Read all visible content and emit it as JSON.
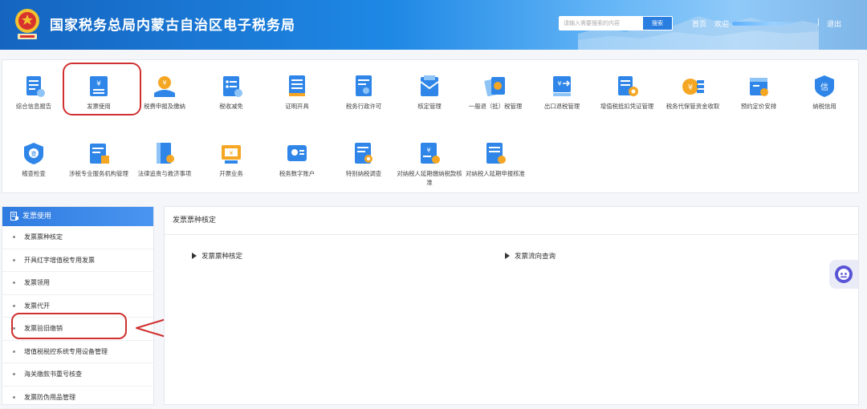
{
  "header": {
    "site_title": "国家税务总局内蒙古自治区电子税务局",
    "search_placeholder": "请输入需要搜索的内容",
    "search_button": "搜索",
    "home_link": "首页",
    "welcome_text": "欢迎",
    "logout_link": "退出",
    "separator": "|"
  },
  "functions": [
    {
      "label": "综合信息报告",
      "icon": "report-icon"
    },
    {
      "label": "发票使用",
      "icon": "invoice-icon"
    },
    {
      "label": "税费申报及缴纳",
      "icon": "tax-declare-icon"
    },
    {
      "label": "税收减免",
      "icon": "tax-reduction-icon"
    },
    {
      "label": "证明开具",
      "icon": "certificate-icon"
    },
    {
      "label": "税务行政许可",
      "icon": "admin-permit-icon"
    },
    {
      "label": "核定管理",
      "icon": "assessment-icon"
    },
    {
      "label": "一般退（抵）税管理",
      "icon": "refund-icon"
    },
    {
      "label": "出口退税管理",
      "icon": "export-refund-icon"
    },
    {
      "label": "增值税抵扣凭证管理",
      "icon": "vat-deduction-icon"
    },
    {
      "label": "税务代保管资金收取",
      "icon": "custody-fund-icon"
    },
    {
      "label": "预约定价安排",
      "icon": "pricing-icon"
    },
    {
      "label": "纳税信用",
      "icon": "credit-icon"
    },
    {
      "label": "稽查检查",
      "icon": "inspection-icon"
    },
    {
      "label": "涉税专业服务机构管理",
      "icon": "agency-icon"
    },
    {
      "label": "法律追责与救济事项",
      "icon": "legal-icon"
    },
    {
      "label": "开票业务",
      "icon": "issue-invoice-icon"
    },
    {
      "label": "税务数字账户",
      "icon": "digital-account-icon"
    },
    {
      "label": "特别纳税调查",
      "icon": "special-investigation-icon"
    },
    {
      "label": "对纳税人延期缴纳税款核准",
      "icon": "deferred-payment-icon"
    },
    {
      "label": "对纳税人延期申报核准",
      "icon": "deferred-declare-icon"
    }
  ],
  "sidebar": {
    "title": "发票使用",
    "items": [
      "发票票种核定",
      "开具红字增值税专用发票",
      "发票领用",
      "发票代开",
      "发票验旧缴销",
      "增值税税控系统专用设备管理",
      "海关缴款书重号核查",
      "发票防伪用品管理"
    ]
  },
  "content": {
    "title": "发票票种核定",
    "links": [
      "发票票种核定",
      "发票流向查询"
    ]
  },
  "colors": {
    "header_blue": "#1e88e5",
    "icon_blue": "#2f86e8",
    "annotation_red": "#d03030"
  }
}
